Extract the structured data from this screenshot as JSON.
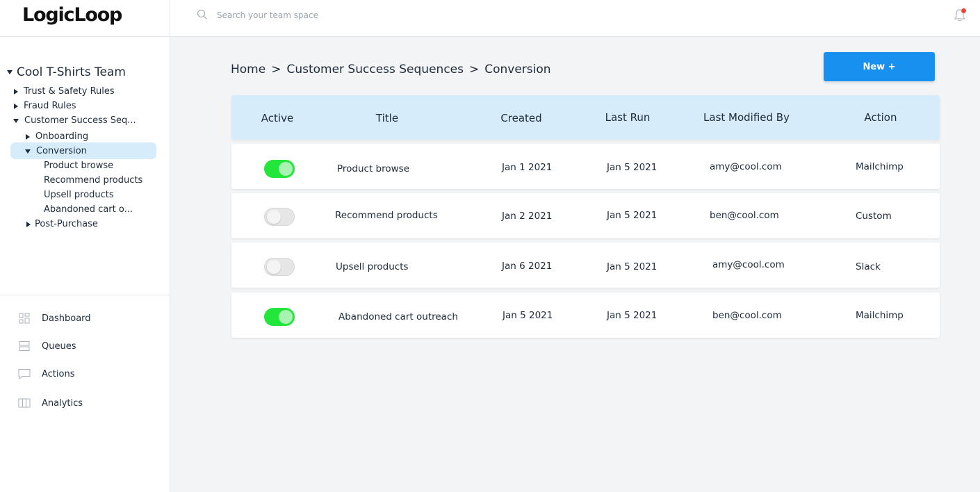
{
  "app": {
    "logo": "LogicLoop"
  },
  "search": {
    "placeholder": "Search your team space"
  },
  "sidebar": {
    "team": "Cool T-Shirts Team",
    "tree": {
      "trust_safety": "Trust & Safety Rules",
      "fraud": "Fraud Rules",
      "customer_success": "Customer Success Seq...",
      "onboarding": "Onboarding",
      "conversion": "Conversion",
      "product_browse": "Product browse",
      "recommend_products": "Recommend products",
      "upsell_products": "Upsell products",
      "abandoned_cart": "Abandoned cart o...",
      "post_purchase": "Post-Purchase"
    },
    "nav": {
      "dashboard": "Dashboard",
      "queues": "Queues",
      "actions": "Actions",
      "analytics": "Analytics"
    }
  },
  "breadcrumb": {
    "home": "Home",
    "sep": ">",
    "section": "Customer Success Sequences",
    "current": "Conversion"
  },
  "new_button": "New +",
  "table": {
    "headers": {
      "active": "Active",
      "title": "Title",
      "created": "Created",
      "last_run": "Last Run",
      "modified_by": "Last Modified By",
      "action": "Action"
    },
    "rows": [
      {
        "active": true,
        "title": "Product browse",
        "created": "Jan 1 2021",
        "last_run": "Jan 5 2021",
        "modified_by": "amy@cool.com",
        "action": "Mailchimp"
      },
      {
        "active": false,
        "title": "Recommend products",
        "created": "Jan 2 2021",
        "last_run": "Jan 5 2021",
        "modified_by": "ben@cool.com",
        "action": "Custom"
      },
      {
        "active": false,
        "title": "Upsell products",
        "created": "Jan 6 2021",
        "last_run": "Jan 5 2021",
        "modified_by": "amy@cool.com",
        "action": "Slack"
      },
      {
        "active": true,
        "title": "Abandoned cart outreach",
        "created": "Jan 5 2021",
        "last_run": "Jan 5 2021",
        "modified_by": "ben@cool.com",
        "action": "Mailchimp"
      }
    ]
  },
  "colors": {
    "accent": "#1890f0",
    "header_bg": "#d6ecfb",
    "toggle_on": "#22e63a",
    "notification_dot": "#f04438"
  }
}
